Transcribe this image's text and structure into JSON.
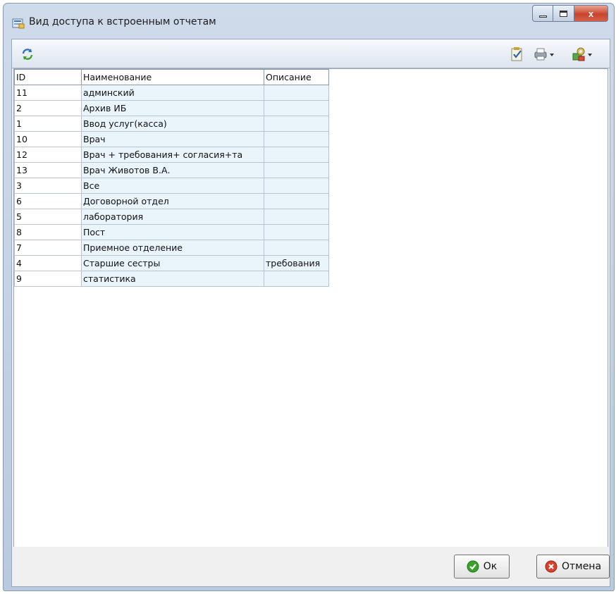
{
  "window": {
    "title": "Вид доступа к встроенным отчетам",
    "close_glyph": "x"
  },
  "toolbar": {
    "refresh_icon": "refresh-icon",
    "right_icons": [
      "checklist-icon",
      "print-icon",
      "tools-icon"
    ]
  },
  "grid": {
    "columns": [
      "ID",
      "Наименование",
      "Описание"
    ],
    "rows": [
      {
        "id": "11",
        "name": "админский",
        "desc": ""
      },
      {
        "id": "2",
        "name": "Архив ИБ",
        "desc": ""
      },
      {
        "id": "1",
        "name": "Ввод услуг(касса)",
        "desc": ""
      },
      {
        "id": "10",
        "name": "Врач",
        "desc": ""
      },
      {
        "id": "12",
        "name": "Врач + требования+ согласия+та",
        "desc": ""
      },
      {
        "id": "13",
        "name": "Врач Животов В.А.",
        "desc": ""
      },
      {
        "id": "3",
        "name": "Все",
        "desc": ""
      },
      {
        "id": "6",
        "name": "Договорной отдел",
        "desc": ""
      },
      {
        "id": "5",
        "name": "лаборатория",
        "desc": ""
      },
      {
        "id": "8",
        "name": "Пост",
        "desc": ""
      },
      {
        "id": "7",
        "name": "Приемное отделение",
        "desc": ""
      },
      {
        "id": "4",
        "name": "Старшие сестры",
        "desc": "требования"
      },
      {
        "id": "9",
        "name": "статистика",
        "desc": ""
      }
    ]
  },
  "footer": {
    "ok_label": "Ок",
    "cancel_label": "Отмена"
  },
  "colors": {
    "accent": "#1e75d0",
    "ok_icon": "#3aa22a",
    "cancel_icon": "#d9412b"
  }
}
